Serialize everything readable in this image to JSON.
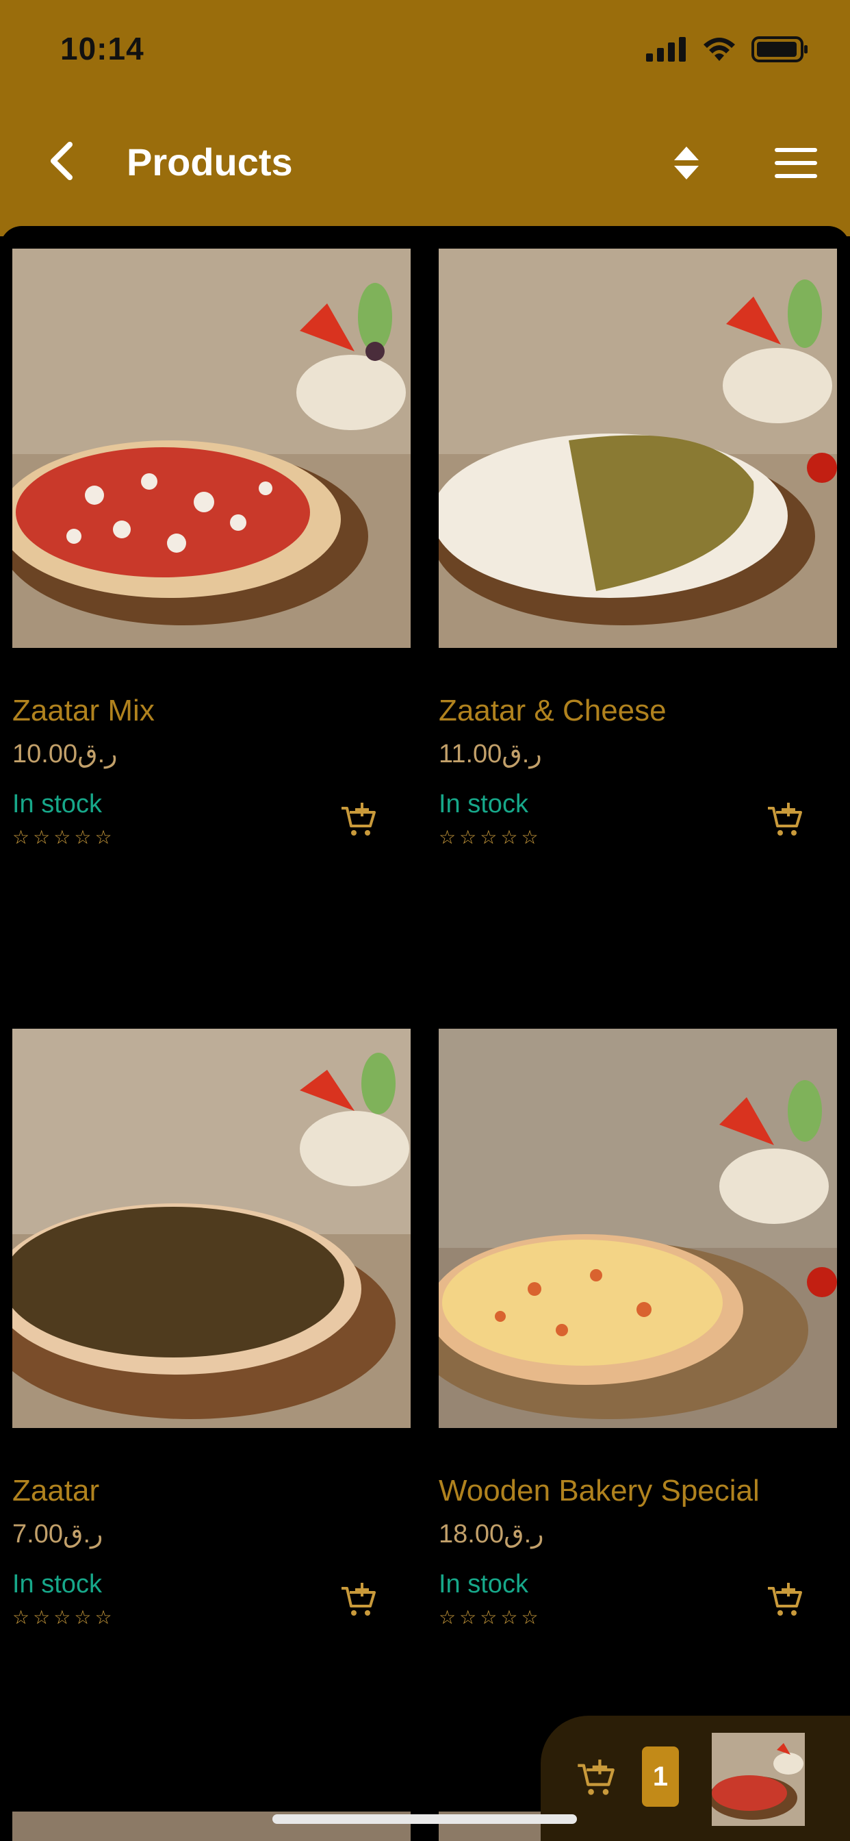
{
  "status": {
    "time": "10:14"
  },
  "nav": {
    "title": "Products",
    "back_icon": "chevron-left-icon",
    "sort_icon": "sort-icon",
    "menu_icon": "hamburger-icon"
  },
  "products": [
    {
      "name": "Zaatar Mix",
      "price": "10.00ر.ق",
      "stock": "In stock",
      "rating": 0,
      "image": "zaatar-mix"
    },
    {
      "name": "Zaatar & Cheese",
      "price": "11.00ر.ق",
      "stock": "In stock",
      "rating": 0,
      "image": "zaatar-cheese"
    },
    {
      "name": "Zaatar",
      "price": "7.00ر.ق",
      "stock": "In stock",
      "rating": 0,
      "image": "zaatar"
    },
    {
      "name": "Wooden Bakery Special",
      "price": "18.00ر.ق",
      "stock": "In stock",
      "rating": 0,
      "image": "wooden-special"
    }
  ],
  "mini_cart": {
    "count": "1"
  },
  "colors": {
    "header": "#9a6d0c",
    "accent": "#b0821e",
    "in_stock": "#17a88a",
    "background": "#000000"
  }
}
